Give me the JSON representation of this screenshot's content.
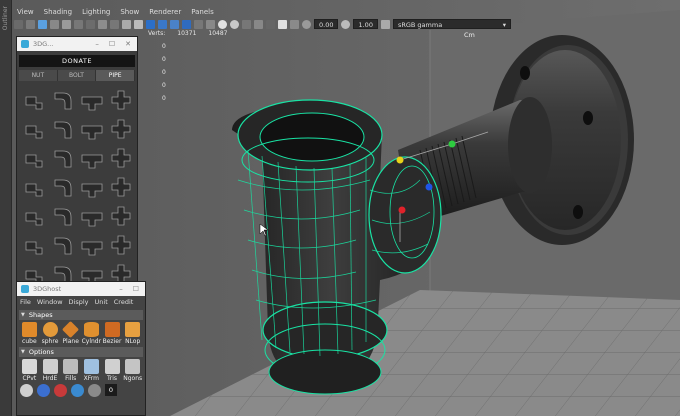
{
  "menubar": {
    "items": [
      "View",
      "Shading",
      "Lighting",
      "Show",
      "Renderer",
      "Panels"
    ]
  },
  "outliner": {
    "label": "Outliner"
  },
  "toolbar": {
    "field_a": "0.00",
    "field_b": "1.00",
    "color_space": "sRGB gamma"
  },
  "hud": {
    "verts_label": "Verts:",
    "verts_value": "10371",
    "verts_value2": "10487",
    "zero_values": [
      "0",
      "0",
      "0",
      "0",
      "0"
    ],
    "units": "Cm"
  },
  "panel1": {
    "title": "3DG...",
    "donate_label": "DONATE",
    "tabs": [
      "NUT",
      "BOLT",
      "PIPE"
    ],
    "active_tab": "PIPE",
    "parts": [
      "pipe-fitting",
      "pipe-elbow",
      "pipe-tee",
      "pipe-cross",
      "pipe-elbow-45",
      "pipe-bend",
      "pipe-tee-reducer",
      "pipe-cap",
      "pipe-elbow-wide",
      "pipe-elbow-short",
      "pipe-coupling",
      "pipe-reducer",
      "pipe-bend-long",
      "pipe-wye",
      "pipe-union",
      "pipe-plug",
      "pipe-flange",
      "pipe-valve",
      "pipe-nipple",
      "pipe-y-branch",
      "pipe-cap-round",
      "pipe-dome",
      "pipe-sleeve",
      "pipe-chevron",
      "pipe-ring",
      "pipe-angle",
      "pipe-manifold",
      "pipe-joint",
      "pipe-curve",
      "pipe-rod",
      "pipe-connector",
      "pipe-tee-small"
    ]
  },
  "panel2": {
    "title": "3DGhost",
    "menu": [
      "File",
      "Window",
      "Disply",
      "Unit",
      "Credit"
    ],
    "shapes_label": "Shapes",
    "shape_tools": [
      "cube",
      "sphre",
      "Plane",
      "Cylndr",
      "Bezier",
      "NLop"
    ],
    "options_label": "Options",
    "option_tools": [
      "CPvt",
      "HrdE",
      "Fills",
      "XFrm",
      "Tris",
      "Ngons"
    ],
    "counter_value": "0"
  },
  "colors": {
    "wire": "#19e3a4",
    "pipe": "#2b2b2b",
    "ui_bg": "#444444",
    "axis_x": "#e0222a",
    "axis_y": "#2ecc40",
    "axis_z": "#1f55e6"
  }
}
